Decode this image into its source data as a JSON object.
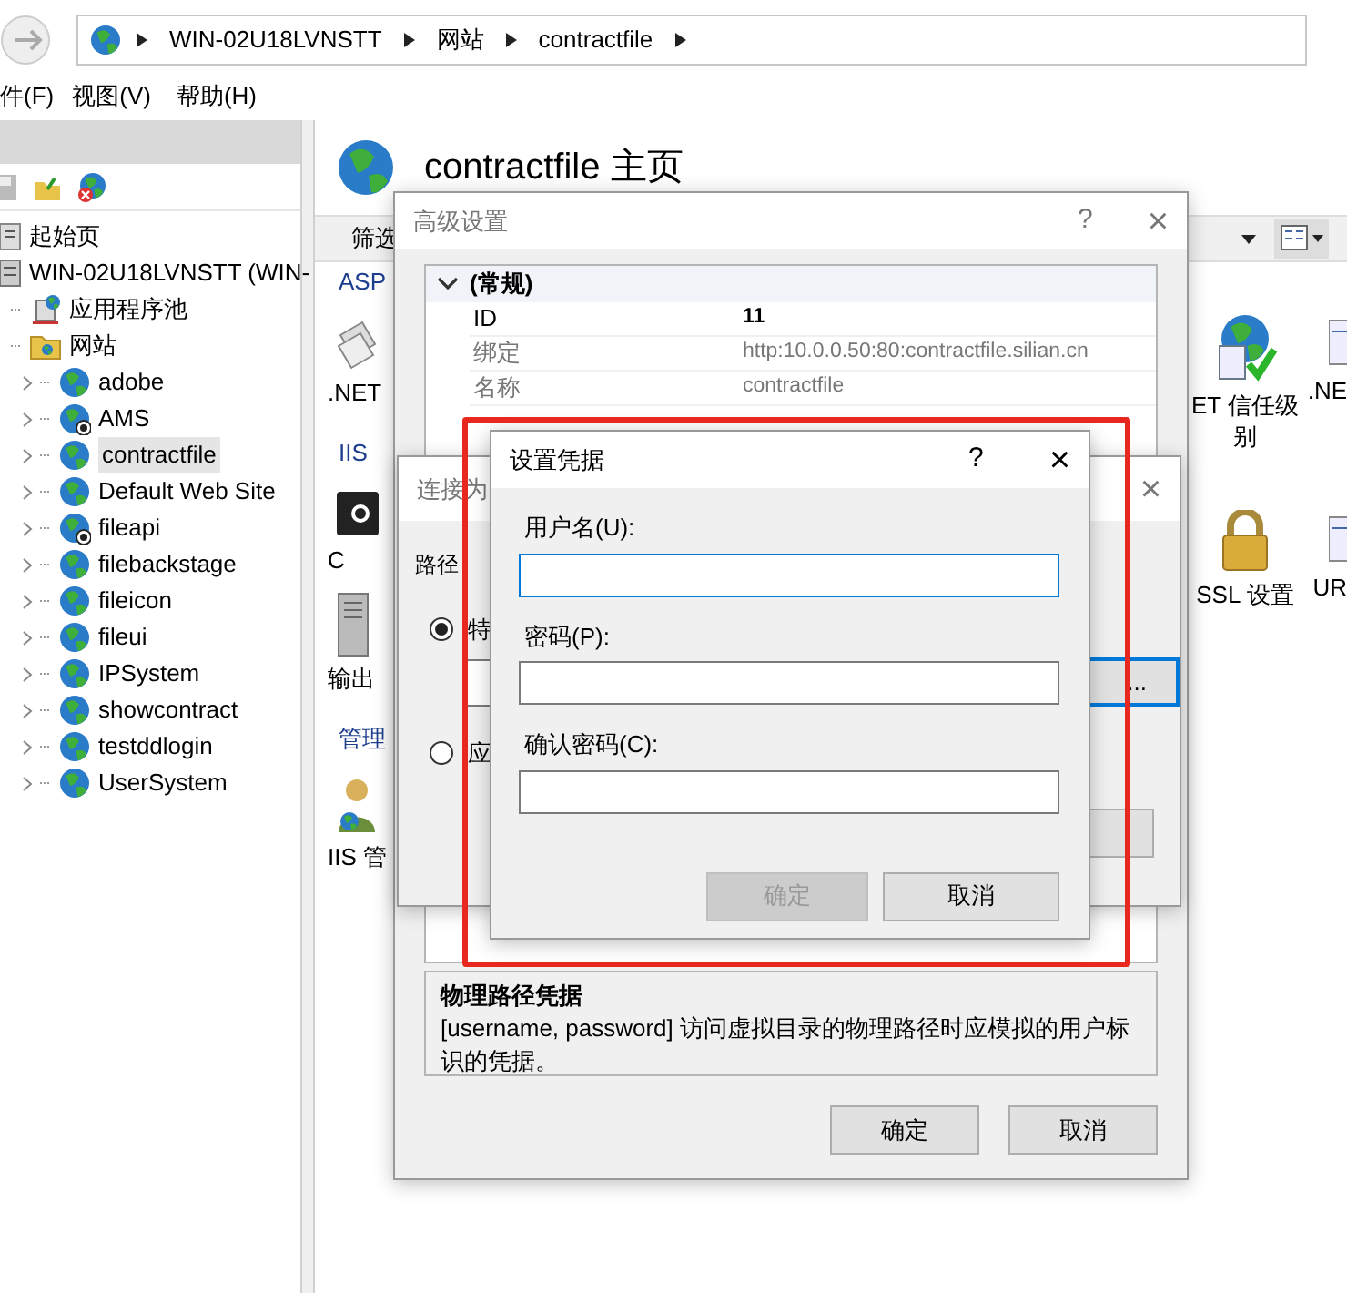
{
  "address_bar": {
    "segments": [
      "WIN-02U18LVNSTT",
      "网站",
      "contractfile"
    ]
  },
  "menu": [
    "件(F)",
    "视图(V)",
    "帮助(H)"
  ],
  "tree": [
    {
      "label": "起始页",
      "kind": "start",
      "selected": false
    },
    {
      "label": "WIN-02U18LVNSTT (WIN-",
      "kind": "server",
      "selected": false,
      "children": [
        {
          "label": "应用程序池",
          "kind": "pool",
          "selected": false
        },
        {
          "label": "网站",
          "kind": "folder",
          "selected": false,
          "children": [
            {
              "label": "adobe",
              "kind": "site",
              "stopped": false,
              "selected": false
            },
            {
              "label": "AMS",
              "kind": "site",
              "stopped": true,
              "selected": false
            },
            {
              "label": "contractfile",
              "kind": "site",
              "stopped": false,
              "selected": true
            },
            {
              "label": "Default Web Site",
              "kind": "site",
              "stopped": false,
              "selected": false
            },
            {
              "label": "fileapi",
              "kind": "site",
              "stopped": true,
              "selected": false
            },
            {
              "label": "filebackstage",
              "kind": "site",
              "stopped": false,
              "selected": false
            },
            {
              "label": "fileicon",
              "kind": "site",
              "stopped": false,
              "selected": false
            },
            {
              "label": "fileui",
              "kind": "site",
              "stopped": false,
              "selected": false
            },
            {
              "label": "IPSystem",
              "kind": "site",
              "stopped": false,
              "selected": false
            },
            {
              "label": "showcontract",
              "kind": "site",
              "stopped": false,
              "selected": false
            },
            {
              "label": "testddlogin",
              "kind": "site",
              "stopped": false,
              "selected": false
            },
            {
              "label": "UserSystem",
              "kind": "site",
              "stopped": false,
              "selected": false
            }
          ]
        }
      ]
    }
  ],
  "home": {
    "title": "contractfile 主页",
    "filter": "筛选",
    "left_features": [
      {
        "kind": "group",
        "label": "ASP"
      },
      {
        "kind": "docs",
        "label": ".NET"
      },
      {
        "kind": "group",
        "label": "IIS"
      },
      {
        "kind": "console",
        "label": "C"
      },
      {
        "kind": "server",
        "label": "输出"
      },
      {
        "kind": "group",
        "label": "管理"
      },
      {
        "kind": "user",
        "label": "IIS 管"
      }
    ],
    "right_features": [
      {
        "kind": "globe-check",
        "label": "ET 信任级别"
      },
      {
        "kind": "doc",
        "label": ".NE"
      },
      {
        "kind": "lock",
        "label": "SSL 设置"
      },
      {
        "kind": "doc",
        "label": "UR"
      }
    ]
  },
  "advanced_settings": {
    "title": "高级设置",
    "help": "?",
    "close": "×",
    "category": {
      "label": "(常规)",
      "expanded": true
    },
    "properties": [
      {
        "name": "ID",
        "value": "11",
        "read_only": false,
        "bold": true
      },
      {
        "name": "绑定",
        "value": "http:10.0.0.50:80:contractfile.silian.cn",
        "read_only": true,
        "bold": false
      },
      {
        "name": "名称",
        "value": "contractfile",
        "read_only": true,
        "bold": false
      }
    ],
    "description": {
      "title": "物理路径凭据",
      "text": "[username, password] 访问虚拟目录的物理路径时应模拟的用户标识的凭据。"
    },
    "buttons": [
      "确定",
      "取消"
    ]
  },
  "connect_as": {
    "title": "连接为",
    "close": "×",
    "label": "路径",
    "options": [
      {
        "label": "特",
        "selected": true
      },
      {
        "label": "应",
        "selected": false
      }
    ],
    "browse": "..."
  },
  "credentials": {
    "title": "设置凭据",
    "help": "?",
    "close": "×",
    "fields": [
      {
        "label": "用户名(U):",
        "focused": true
      },
      {
        "label": "密码(P):",
        "focused": false
      },
      {
        "label": "确认密码(C):",
        "focused": false
      }
    ],
    "buttons": [
      {
        "label": "确定",
        "disabled": true
      },
      {
        "label": "取消",
        "disabled": false
      }
    ]
  }
}
